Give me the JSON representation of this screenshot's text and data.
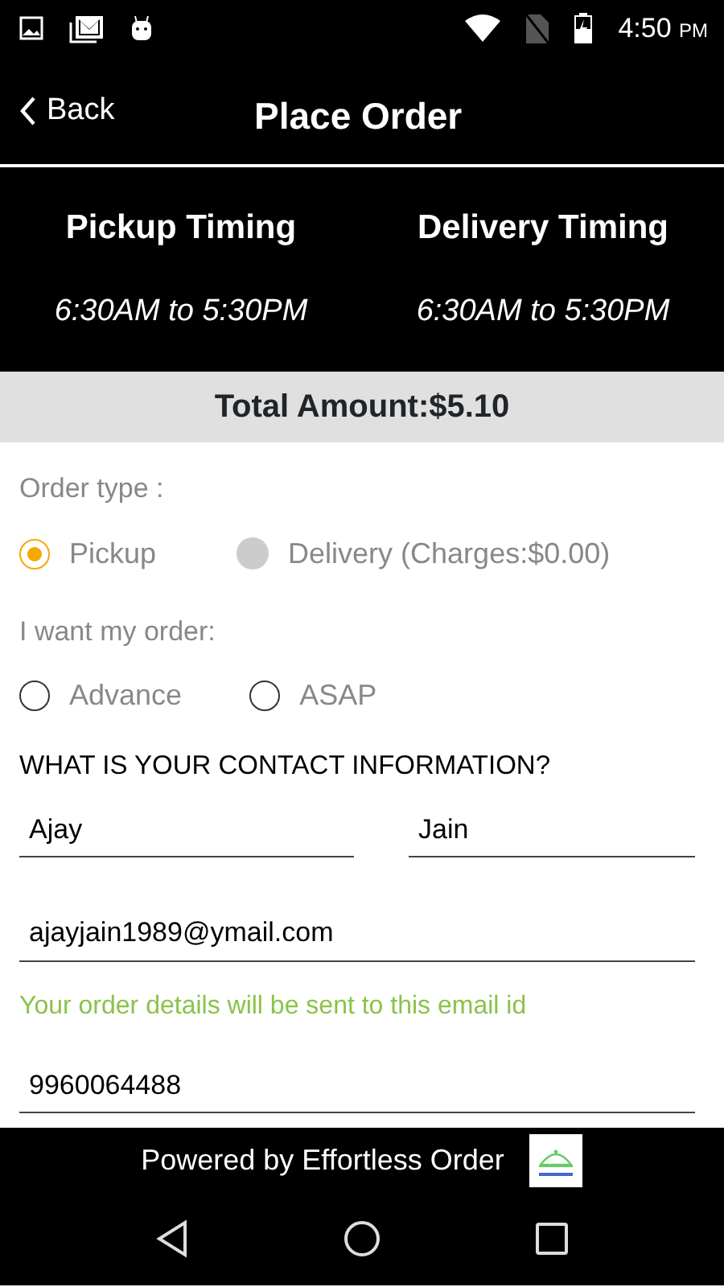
{
  "status_bar": {
    "time": "4:50",
    "ampm": "PM"
  },
  "header": {
    "back": "Back",
    "title": "Place Order"
  },
  "timings": [
    {
      "title": "Pickup Timing",
      "hours": "6:30AM to 5:30PM"
    },
    {
      "title": "Delivery Timing",
      "hours": "6:30AM to 5:30PM"
    }
  ],
  "total": "Total Amount:$5.10",
  "order_type": {
    "label": "Order type :",
    "options": [
      {
        "label": "Pickup",
        "selected": true,
        "disabled": false
      },
      {
        "label": "Delivery (Charges:$0.00)",
        "selected": false,
        "disabled": true
      }
    ]
  },
  "timing_choice": {
    "label": "I want my order:",
    "options": [
      {
        "label": "Advance",
        "selected": false,
        "disabled": false
      },
      {
        "label": "ASAP",
        "selected": false,
        "disabled": false
      }
    ]
  },
  "contact": {
    "heading": "WHAT IS YOUR CONTACT INFORMATION?",
    "first_name": "Ajay",
    "last_name": "Jain",
    "email": "ajayjain1989@ymail.com",
    "email_hint": "Your order details will be sent to this email id",
    "phone": "9960064488"
  },
  "footer": "Powered by Effortless Order"
}
